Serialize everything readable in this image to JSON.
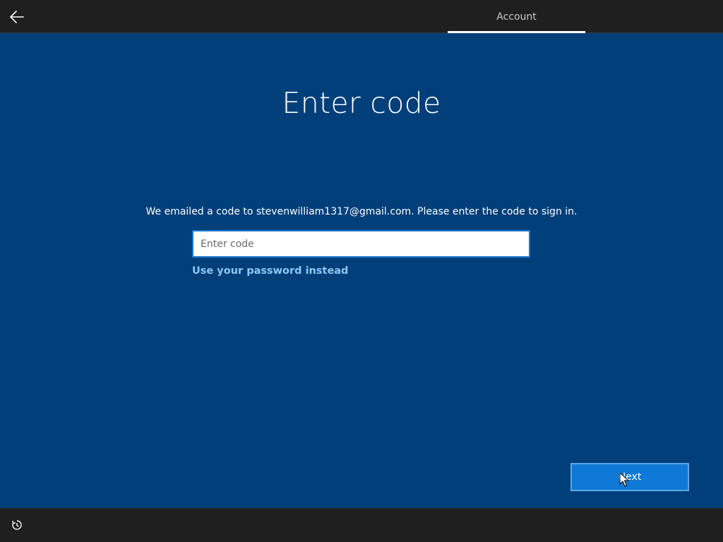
{
  "header": {
    "back_icon": "back-arrow-icon",
    "tab_label": "Account"
  },
  "main": {
    "title": "Enter code",
    "instruction": "We emailed a code to stevenwilliam1317@gmail.com. Please enter the code to sign in.",
    "code_input": {
      "value": "",
      "placeholder": "Enter code"
    },
    "alt_link": "Use your password instead"
  },
  "footer": {
    "next_label": "Next",
    "ease_icon": "ease-of-access-icon"
  },
  "colors": {
    "background": "#003f7a",
    "bars": "#1f1f1f",
    "accent": "#0f78d7",
    "link": "#8fc8f5"
  }
}
